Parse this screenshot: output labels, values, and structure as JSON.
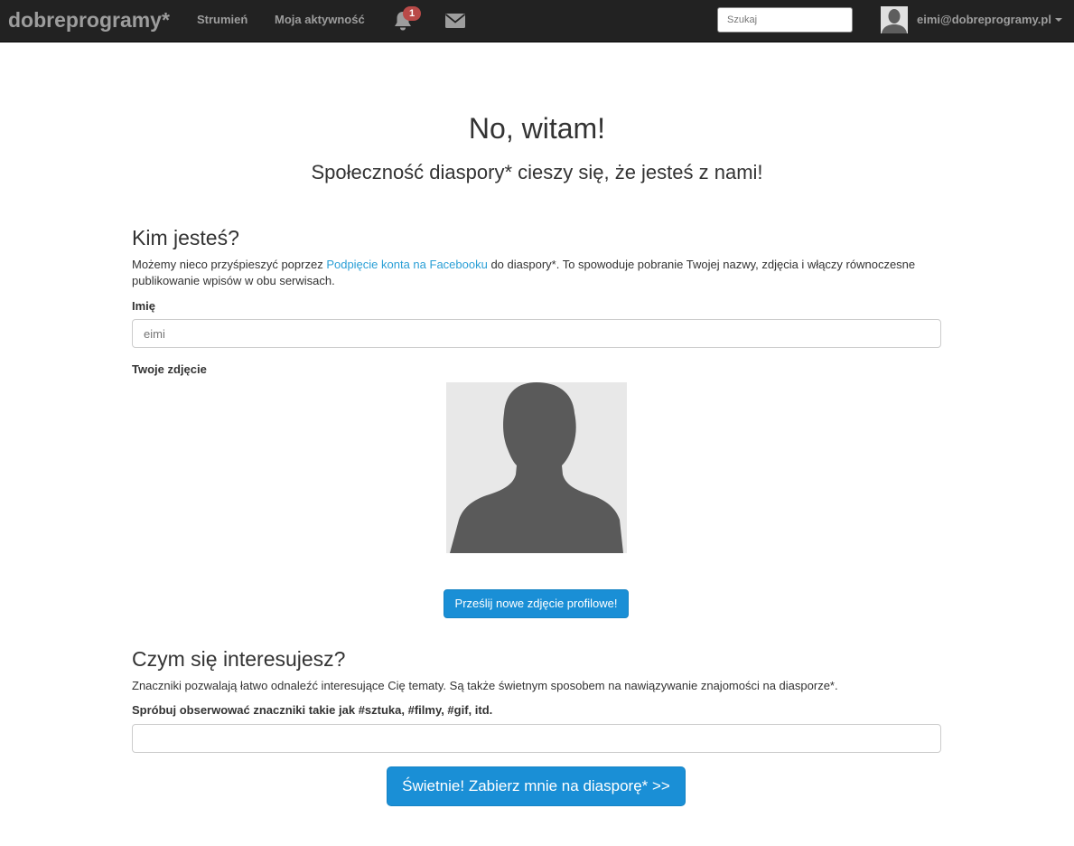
{
  "navbar": {
    "brand": "dobreprogramy*",
    "links": [
      {
        "label": "Strumień"
      },
      {
        "label": "Moja aktywność"
      }
    ],
    "notifications": {
      "count": "1",
      "icon": "notifications-icon"
    },
    "messages": {
      "icon": "mail-icon"
    },
    "search": {
      "placeholder": "Szukaj"
    },
    "user": {
      "name": "eimi@dobreprogramy.pl",
      "icon": "caret-down-icon"
    }
  },
  "hero": {
    "title": "No, witam!",
    "subtitle": "Społeczność diaspory* cieszy się, że jesteś z nami!"
  },
  "profile_section": {
    "heading": "Kim jesteś?",
    "intro_before": "Możemy nieco przyśpieszyć poprzez ",
    "intro_link": "Podpięcie konta na Facebooku",
    "intro_after": " do diaspory*. To spowoduje pobranie Twojej nazwy, zdjęcia i włączy równoczesne publikowanie wpisów w obu serwisach.",
    "name_label": "Imię",
    "name_placeholder": "eimi",
    "photo_label": "Twoje zdjęcie",
    "upload_button": "Prześlij nowe zdjęcie profilowe!"
  },
  "interests_section": {
    "heading": "Czym się interesujesz?",
    "intro": "Znaczniki pozwalają łatwo odnaleźć interesujące Cię tematy. Są także świetnym sposobem na nawiązywanie znajomości na diasporze*.",
    "tags_label": "Spróbuj obserwować znaczniki takie jak #sztuka, #filmy, #gif, itd.",
    "tags_value": ""
  },
  "continue_button": "Świetnie! Zabierz mnie na diasporę* >>",
  "colors": {
    "navbar_bg": "#222222",
    "nav_text": "#9d9d9d",
    "badge": "#b94a48",
    "link": "#2a9fd6",
    "primary_button": "#1a8fd6"
  }
}
